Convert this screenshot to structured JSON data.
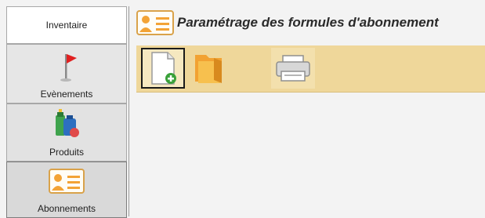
{
  "sidebar": {
    "items": [
      {
        "label": "Inventaire",
        "icon": "inventory-tab"
      },
      {
        "label": "Evènements",
        "icon": "red-flag-icon"
      },
      {
        "label": "Produits",
        "icon": "products-icon"
      },
      {
        "label": "Abonnements",
        "icon": "id-card-icon"
      }
    ]
  },
  "header": {
    "title": "Paramétrage des formules d'abonnement",
    "icon": "id-card-icon"
  },
  "toolbar": {
    "buttons": [
      {
        "name": "new-document",
        "icon": "new-document-icon"
      },
      {
        "name": "open-folder",
        "icon": "folder-icon"
      },
      {
        "name": "print",
        "icon": "printer-icon"
      }
    ]
  },
  "colors": {
    "toolbar_bg": "#efd79a",
    "accent_orange": "#f3a336",
    "flag_red": "#e02020"
  }
}
